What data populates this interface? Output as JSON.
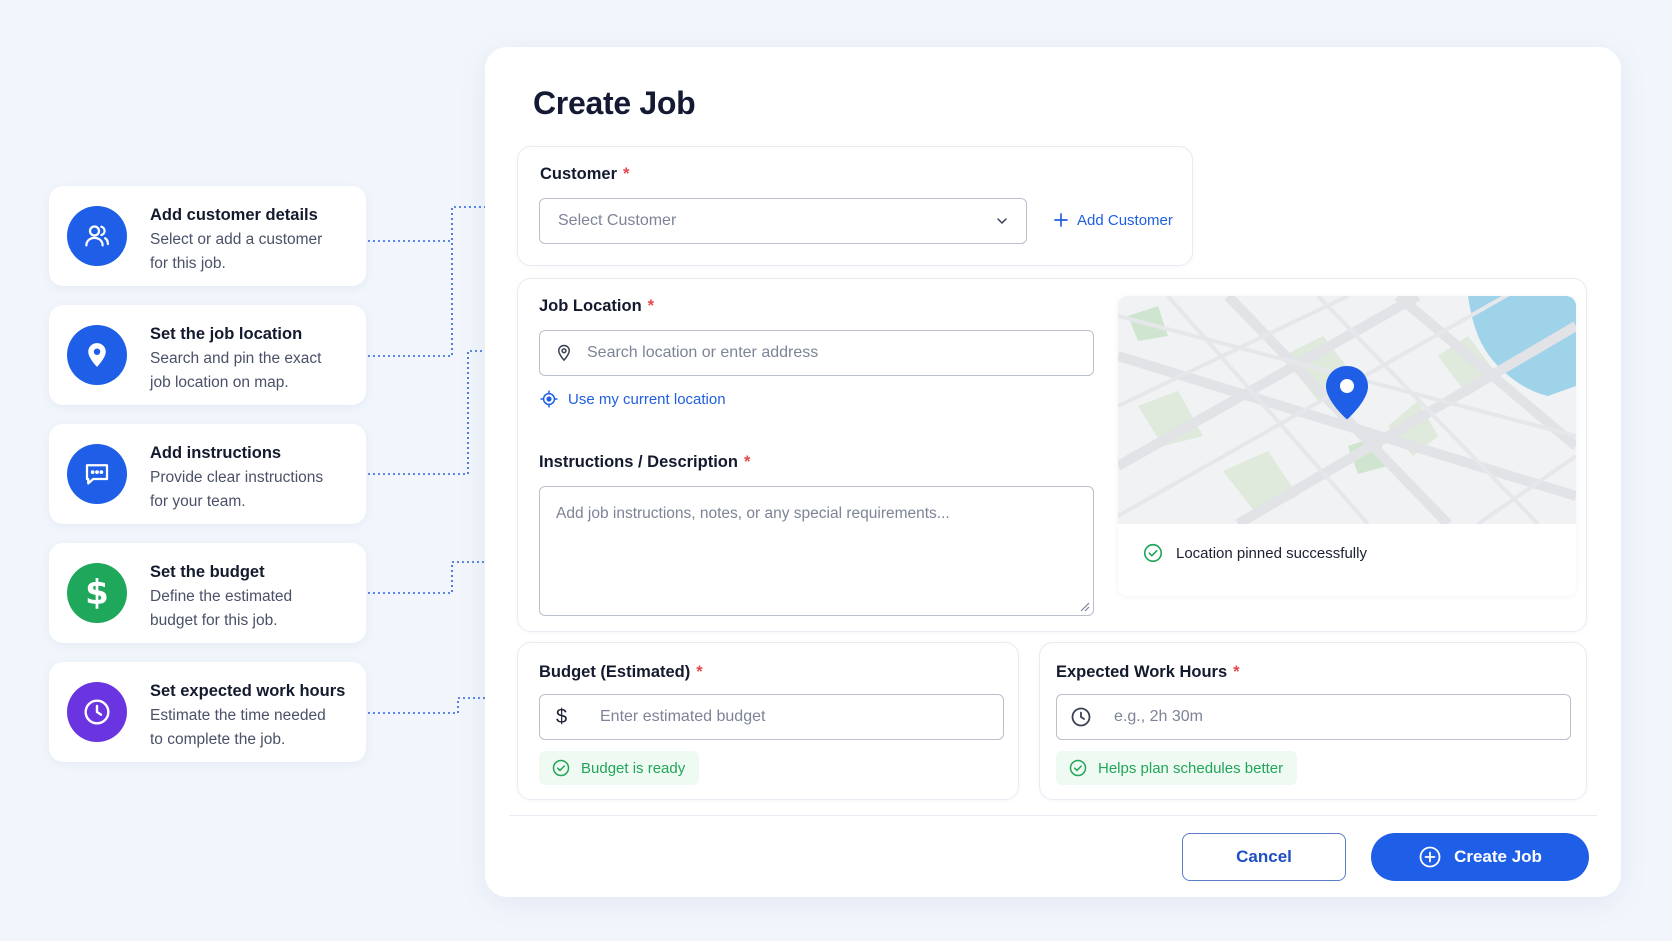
{
  "steps": [
    {
      "title": "Add customer details",
      "desc1": "Select or add a customer",
      "desc2": "for this job.",
      "icon": "user-group-icon",
      "color": "#1f5fe8"
    },
    {
      "title": "Set the job location",
      "desc1": "Search and pin the exact",
      "desc2": "job location on map.",
      "icon": "map-pin-icon",
      "color": "#1f5fe8"
    },
    {
      "title": "Add instructions",
      "desc1": "Provide clear instructions",
      "desc2": "for your team.",
      "icon": "chat-icon",
      "color": "#1f5fe8"
    },
    {
      "title": "Set the budget",
      "desc1": "Define the estimated",
      "desc2": "budget for this job.",
      "icon": "dollar-icon",
      "color": "#1fa85b"
    },
    {
      "title": "Set expected work hours",
      "desc1": "Estimate the time needed",
      "desc2": "to complete the job.",
      "icon": "clock-icon",
      "color": "#6a35e0"
    }
  ],
  "modal": {
    "title": "Create Job",
    "customer": {
      "label": "Customer",
      "required": "*",
      "placeholder": "Select Customer",
      "add_label": "Add Customer"
    },
    "location": {
      "label": "Job Location",
      "required": "*",
      "placeholder": "Search location or enter address",
      "current_location": "Use my current location",
      "pinned_status": "Location pinned successfully"
    },
    "instructions": {
      "label": "Instructions / Description",
      "required": "*",
      "placeholder": "Add job instructions, notes, or any special requirements..."
    },
    "budget": {
      "label": "Budget (Estimated)",
      "required": "*",
      "prefix": "$",
      "placeholder": "Enter estimated budget",
      "status": "Budget is ready"
    },
    "hours": {
      "label": "Expected Work Hours",
      "required": "*",
      "placeholder": "e.g., 2h 30m",
      "status": "Helps plan schedules better"
    },
    "cancel_label": "Cancel",
    "create_label": "Create Job"
  },
  "colors": {
    "accent": "#1f5fe8",
    "success": "#23a55a",
    "required": "#e5484d"
  }
}
